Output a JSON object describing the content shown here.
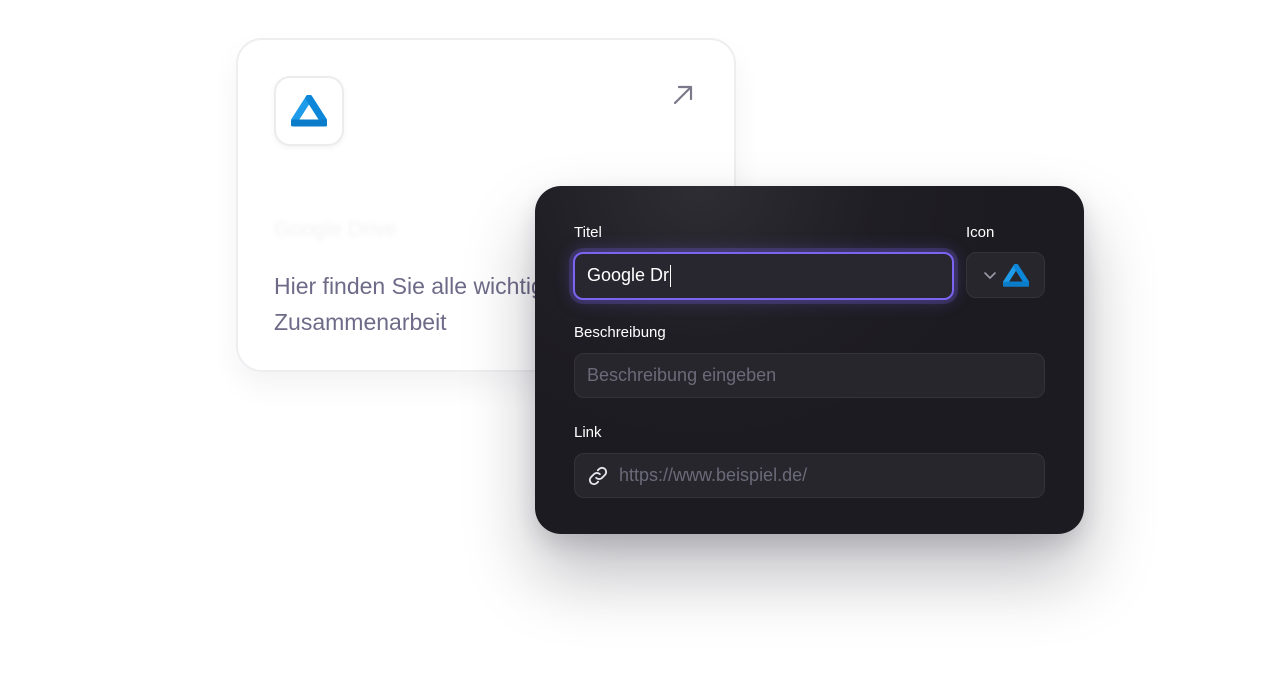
{
  "card": {
    "app_icon": "google-drive-icon",
    "arrow_icon": "arrow-up-right-icon",
    "faded_title": "Google Drive",
    "description": "Hier finden Sie alle wichtigen Dateien zur Zusammenarbeit"
  },
  "form": {
    "title_label": "Titel",
    "title_value": "Google Dr",
    "icon_label": "Icon",
    "icon_select": {
      "chevron_icon": "chevron-down-icon",
      "selected_icon": "google-drive-icon"
    },
    "description_label": "Beschreibung",
    "description_placeholder": "Beschreibung eingeben",
    "link_label": "Link",
    "link_icon": "link-icon",
    "link_placeholder": "https://www.beispiel.de/"
  },
  "colors": {
    "accent": "#7a64f2",
    "drive_blue_light": "#2aa8f0",
    "drive_blue_dark": "#0c86d8",
    "panel_bg": "#1f1e24",
    "card_text": "#6d6b88"
  }
}
